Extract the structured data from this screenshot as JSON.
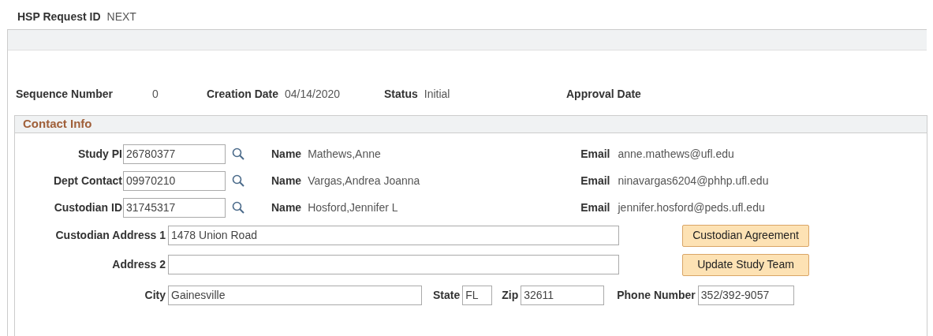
{
  "header": {
    "label": "HSP Request ID",
    "value": "NEXT"
  },
  "status_row": [
    {
      "label": "Sequence Number",
      "value": "0"
    },
    {
      "label": "Creation Date",
      "value": "04/14/2020"
    },
    {
      "label": "Status",
      "value": "Initial"
    },
    {
      "label": "Approval Date"
    }
  ],
  "section": {
    "title": "Contact Info"
  },
  "contacts": [
    {
      "label": "Study PI",
      "id": "26780377",
      "name_label": "Name",
      "name": "Mathews,Anne",
      "email_label": "Email",
      "email": "anne.mathews@ufl.edu"
    },
    {
      "label": "Dept Contact",
      "id": "09970210",
      "name_label": "Name",
      "name": "Vargas,Andrea Joanna",
      "email_label": "Email",
      "email": "ninavargas6204@phhp.ufl.edu"
    },
    {
      "label": "Custodian ID",
      "id": "31745317",
      "name_label": "Name",
      "name": "Hosford,Jennifer L",
      "email_label": "Email",
      "email": "jennifer.hosford@peds.ufl.edu"
    }
  ],
  "address": [
    {
      "label": "Custodian Address 1",
      "value": "1478 Union Road",
      "button": "Custodian Agreement"
    },
    {
      "label": "Address 2",
      "button": "Update Study Team"
    }
  ],
  "city_row": {
    "city_label": "City",
    "city": "Gainesville",
    "state_label": "State",
    "state": "FL",
    "zip_label": "Zip",
    "zip": "32611",
    "phone_label": "Phone Number",
    "phone": "352/392-9057"
  }
}
